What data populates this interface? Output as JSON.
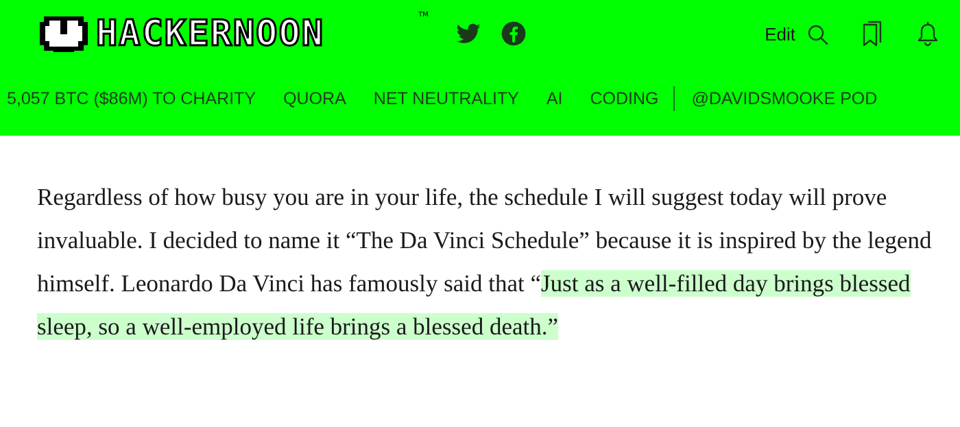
{
  "brand": {
    "name": "HACKERNOON",
    "tm": "TM"
  },
  "social": [
    {
      "icon": "twitter-icon"
    },
    {
      "icon": "facebook-icon"
    }
  ],
  "actions": {
    "edit_label": "Edit"
  },
  "nav": {
    "items": [
      "5,057 BTC ($86M) TO CHARITY",
      "QUORA",
      "NET NEUTRALITY",
      "AI",
      "CODING"
    ],
    "pinned": "@DAVIDSMOOKE POD"
  },
  "article": {
    "paragraph_start": "Regardless of how busy you are in your life, the schedule I will suggest today will prove invaluable. I decided to name it “The Da Vinci Schedule” because it is inspired by the legend himself. Leonardo Da Vinci has famously said that “",
    "highlighted_quote": "Just as a well-filled day brings blessed sleep, so a well-employed life brings a blessed death.”"
  },
  "colors": {
    "header_bg": "#00ff00",
    "highlight_bg": "#ccffcc"
  }
}
